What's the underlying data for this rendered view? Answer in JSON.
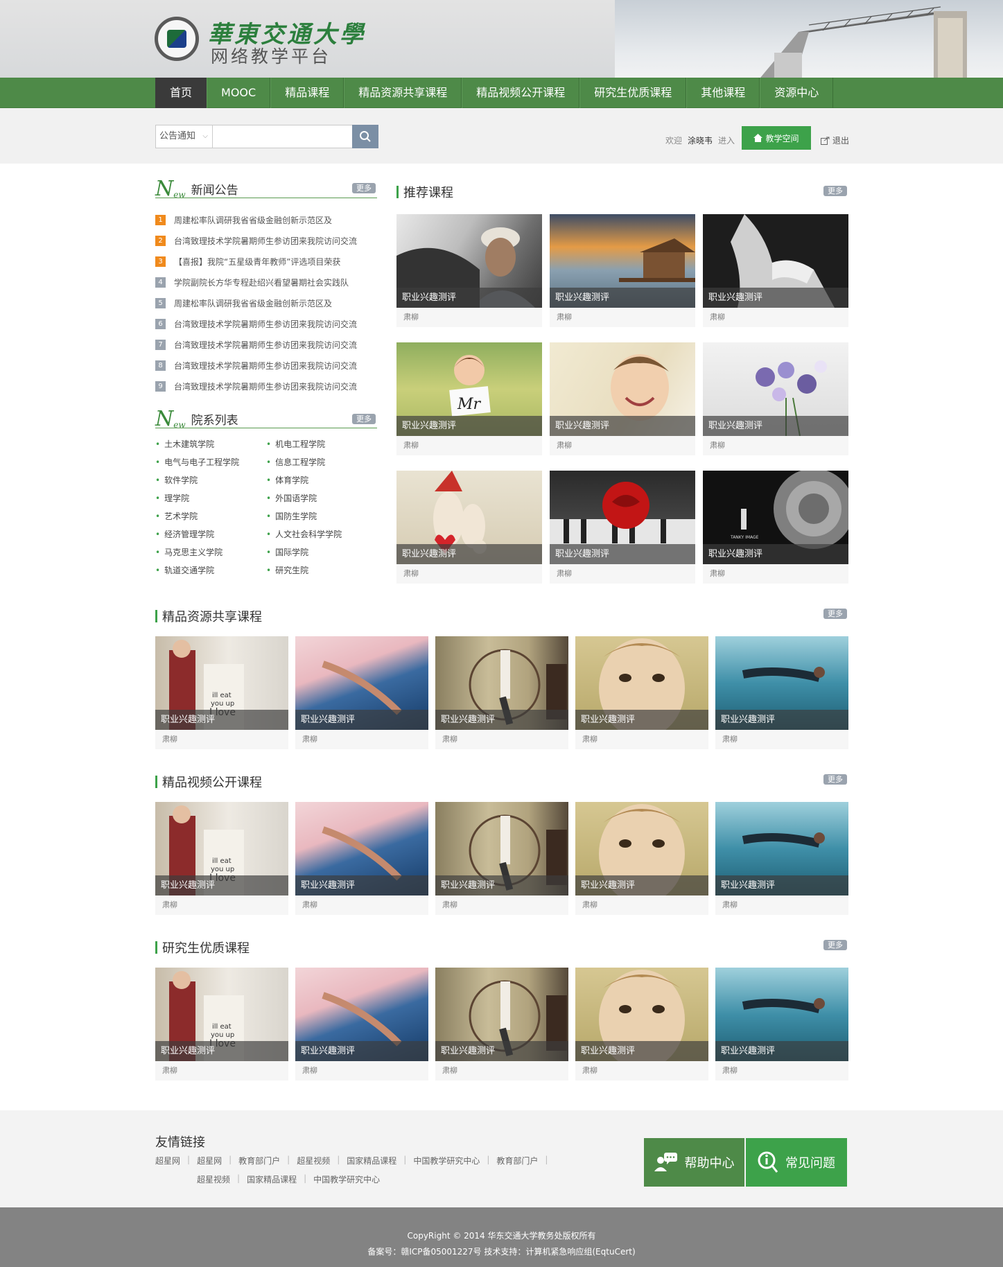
{
  "header": {
    "logo_cn": "華東交通大學",
    "logo_sub": "网络教学平台"
  },
  "nav": [
    "首页",
    "MOOC",
    "精品课程",
    "精品资源共享课程",
    "精品视频公开课程",
    "研究生优质课程",
    "其他课程",
    "资源中心"
  ],
  "search": {
    "category": "公告通知",
    "placeholder": ""
  },
  "user": {
    "welcome": "欢迎",
    "name": "涂晓韦",
    "enter": "进入",
    "space_button": "教学空间",
    "logout": "退出"
  },
  "more_label": "更多",
  "news": {
    "title": "新闻公告",
    "items": [
      {
        "num": "1",
        "text": "周建松率队调研我省省级金融创新示范区及"
      },
      {
        "num": "2",
        "text": "台湾致理技术学院暑期师生参访团来我院访问交流"
      },
      {
        "num": "3",
        "text": "【喜报】我院“五星级青年教师”评选项目荣获"
      },
      {
        "num": "4",
        "text": "学院副院长方华专程赴绍兴看望暑期社会实践队"
      },
      {
        "num": "5",
        "text": "周建松率队调研我省省级金融创新示范区及"
      },
      {
        "num": "6",
        "text": "台湾致理技术学院暑期师生参访团来我院访问交流"
      },
      {
        "num": "7",
        "text": "台湾致理技术学院暑期师生参访团来我院访问交流"
      },
      {
        "num": "8",
        "text": "台湾致理技术学院暑期师生参访团来我院访问交流"
      },
      {
        "num": "9",
        "text": "台湾致理技术学院暑期师生参访团来我院访问交流"
      }
    ]
  },
  "departments": {
    "title": "院系列表",
    "items": [
      "土木建筑学院",
      "机电工程学院",
      "电气与电子工程学院",
      "信息工程学院",
      "软件学院",
      "体育学院",
      "理学院",
      "外国语学院",
      "艺术学院",
      "国防生学院",
      "经济管理学院",
      "人文社会科学学院",
      "马克思主义学院",
      "国际学院",
      "轨道交通学院",
      "研究生院"
    ]
  },
  "recommended": {
    "title": "推荐课程",
    "cards": [
      {
        "caption": "职业兴趣测评",
        "author": "肃柳"
      },
      {
        "caption": "职业兴趣测评",
        "author": "肃柳"
      },
      {
        "caption": "职业兴趣测评",
        "author": "肃柳"
      },
      {
        "caption": "职业兴趣测评",
        "author": "肃柳"
      },
      {
        "caption": "职业兴趣测评",
        "author": "肃柳"
      },
      {
        "caption": "职业兴趣测评",
        "author": "肃柳"
      },
      {
        "caption": "职业兴趣测评",
        "author": "肃柳"
      },
      {
        "caption": "职业兴趣测评",
        "author": "肃柳"
      },
      {
        "caption": "职业兴趣测评",
        "author": "肃柳"
      }
    ],
    "image_text": {
      "mr": "Mr",
      "tanky": "TANKY IMAGE"
    }
  },
  "sections": [
    {
      "title": "精品资源共享课程",
      "cards": [
        {
          "caption": "职业兴趣测评",
          "author": "肃柳"
        },
        {
          "caption": "职业兴趣测评",
          "author": "肃柳"
        },
        {
          "caption": "职业兴趣测评",
          "author": "肃柳"
        },
        {
          "caption": "职业兴趣测评",
          "author": "肃柳"
        },
        {
          "caption": "职业兴趣测评",
          "author": "肃柳"
        }
      ]
    },
    {
      "title": "精品视频公开课程",
      "cards": [
        {
          "caption": "职业兴趣测评",
          "author": "肃柳"
        },
        {
          "caption": "职业兴趣测评",
          "author": "肃柳"
        },
        {
          "caption": "职业兴趣测评",
          "author": "肃柳"
        },
        {
          "caption": "职业兴趣测评",
          "author": "肃柳"
        },
        {
          "caption": "职业兴趣测评",
          "author": "肃柳"
        }
      ]
    },
    {
      "title": "研究生优质课程",
      "cards": [
        {
          "caption": "职业兴趣测评",
          "author": "肃柳"
        },
        {
          "caption": "职业兴趣测评",
          "author": "肃柳"
        },
        {
          "caption": "职业兴趣测评",
          "author": "肃柳"
        },
        {
          "caption": "职业兴趣测评",
          "author": "肃柳"
        },
        {
          "caption": "职业兴趣测评",
          "author": "肃柳"
        }
      ]
    }
  ],
  "poster_text": [
    "ill eat",
    "you up",
    "I love",
    "you"
  ],
  "friend_links": {
    "title": "友情链接",
    "items": [
      "超星网",
      "超星网",
      "教育部门户",
      "超星视频",
      "国家精品课程",
      "中国教学研究中心",
      "教育部门户",
      "超星视频",
      "国家精品课程",
      "中国教学研究中心"
    ]
  },
  "help": {
    "help_center": "帮助中心",
    "faq": "常见问题"
  },
  "footer": {
    "copyright": "CopyRight © 2014 华东交通大学教务处版权所有",
    "icp": "备案号：赣ICP备05001227号 技术支持：计算机紧急响应组(EqtuCert)"
  }
}
